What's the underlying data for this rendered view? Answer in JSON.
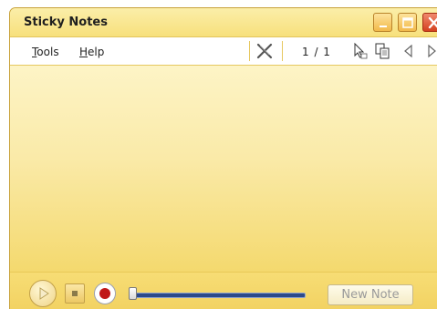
{
  "window": {
    "title": "Sticky Notes",
    "controls": {
      "minimize_icon": "minimize-icon",
      "maximize_icon": "maximize-icon",
      "close_icon": "close-icon"
    }
  },
  "menu": {
    "tools": {
      "mnemonic": "T",
      "rest": "ools"
    },
    "help": {
      "mnemonic": "H",
      "rest": "elp"
    }
  },
  "toolbar": {
    "delete_icon": "delete-note-icon",
    "note_counter": "1 / 1",
    "pointer_icon": "pointer-icon",
    "copy_icon": "copy-icon",
    "previous_icon": "previous-note-icon",
    "next_icon": "next-note-icon"
  },
  "note": {
    "text": ""
  },
  "playback": {
    "play_icon": "play-icon",
    "stop_icon": "stop-icon",
    "record_icon": "record-icon",
    "position": 0
  },
  "actions": {
    "new_note_label": "New Note"
  },
  "colors": {
    "note_yellow": "#f6e28a",
    "title_bar": "#fbeea9",
    "close_red": "#d4401f",
    "record_red": "#c01818",
    "slider_blue": "#2c4a8a"
  }
}
